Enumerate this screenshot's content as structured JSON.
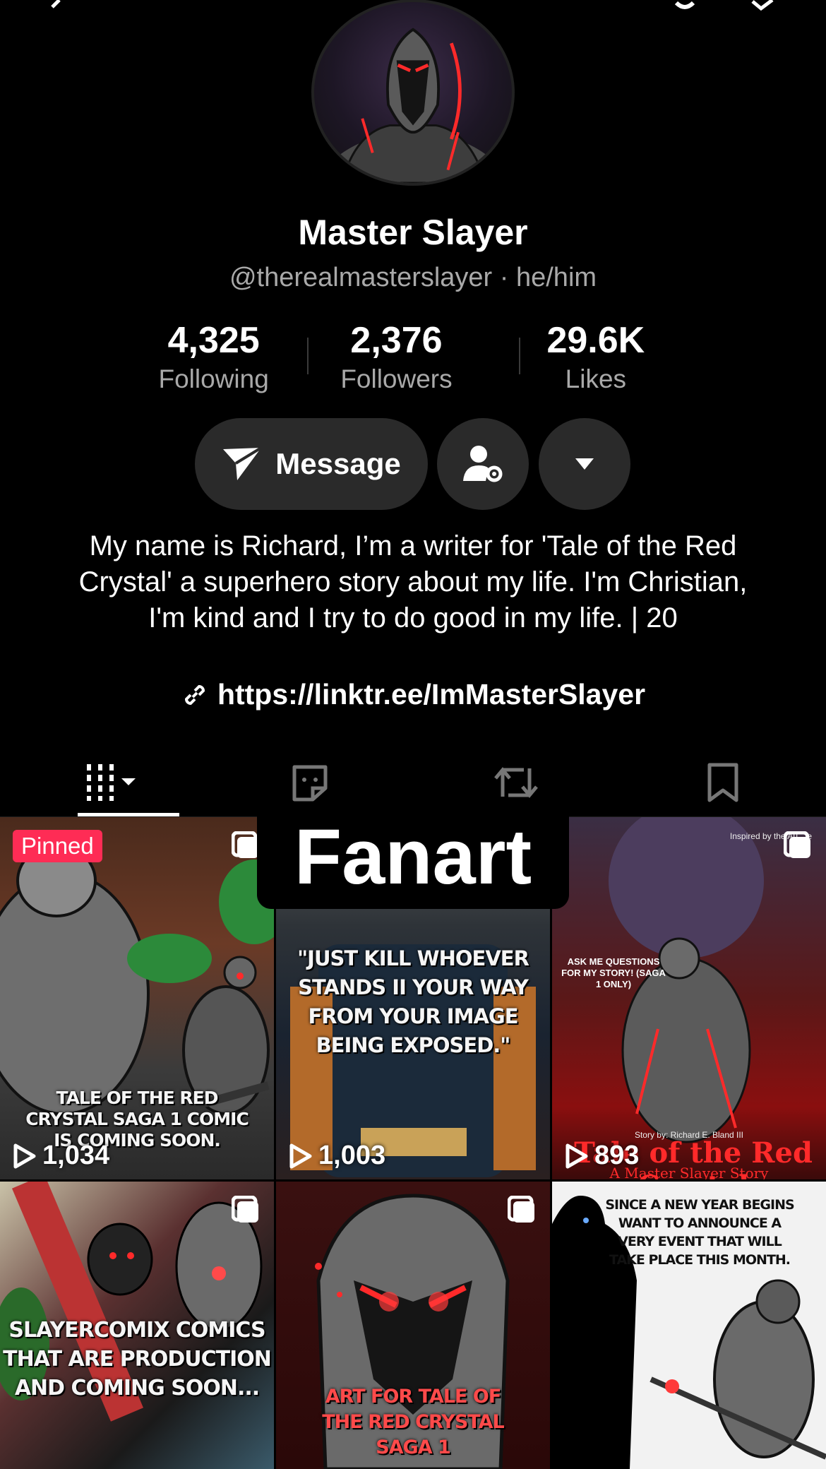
{
  "profile": {
    "name": "Master Slayer",
    "handle": "@therealmasterslayer · he/him",
    "stats": [
      {
        "value": "4,325",
        "label": "Following"
      },
      {
        "value": "2,376",
        "label": "Followers"
      },
      {
        "value": "29.6K",
        "label": "Likes"
      }
    ],
    "bio": "My name is Richard, I’m a writer for 'Tale of the Red Crystal' a superhero story about my life. I'm Christian, I'm kind and I try to do good in my life. | 20",
    "link": "https://linktr.ee/ImMasterSlayer"
  },
  "actions": {
    "message_label": "Message",
    "add_friend_icon": "person-gear-icon",
    "more_icon": "caret-down-icon"
  },
  "tabs": [
    {
      "icon": "videos-grid-icon",
      "active": true
    },
    {
      "icon": "private-sticker-icon",
      "active": false
    },
    {
      "icon": "repost-icon",
      "active": false
    },
    {
      "icon": "bookmark-icon",
      "active": false
    }
  ],
  "overlay_label": "Fanart",
  "videos": [
    {
      "pinned": "Pinned",
      "caption": "TALE OF THE RED CRYSTAL SAGA 1 COMIC IS COMING SOON.",
      "views": "1,034"
    },
    {
      "caption": "\"JUST KILL WHOEVER STANDS II YOUR WAY FROM YOUR IMAGE BEING EXPOSED.\"",
      "views": "1,003"
    },
    {
      "caption": "ASK ME QUESTIONS FOR MY STORY! (SAGA 1 ONLY)",
      "caption2": "Tale of the Red Crystal",
      "caption3": "A Master Slayer Story",
      "small_top": "Inspired by the Au...fe",
      "small_credit": "Story by: Richard E. Bland III",
      "views": "893"
    },
    {
      "caption": "SLAYERCOMIX COMICS THAT ARE PRODUCTION AND COMING SOON...",
      "banner": "SLAYERCOMIX"
    },
    {
      "caption": "ART FOR TALE OF THE RED CRYSTAL SAGA 1"
    },
    {
      "caption": "SINCE A NEW YEAR BEGINS WANT TO ANNOUNCE A VERY EVENT THAT WILL TAKE PLACE THIS MONTH."
    }
  ],
  "colors": {
    "background": "#000000",
    "button": "#2a2a2a",
    "pinned": "#fe2c55",
    "muted_text": "#a9a9a9"
  }
}
